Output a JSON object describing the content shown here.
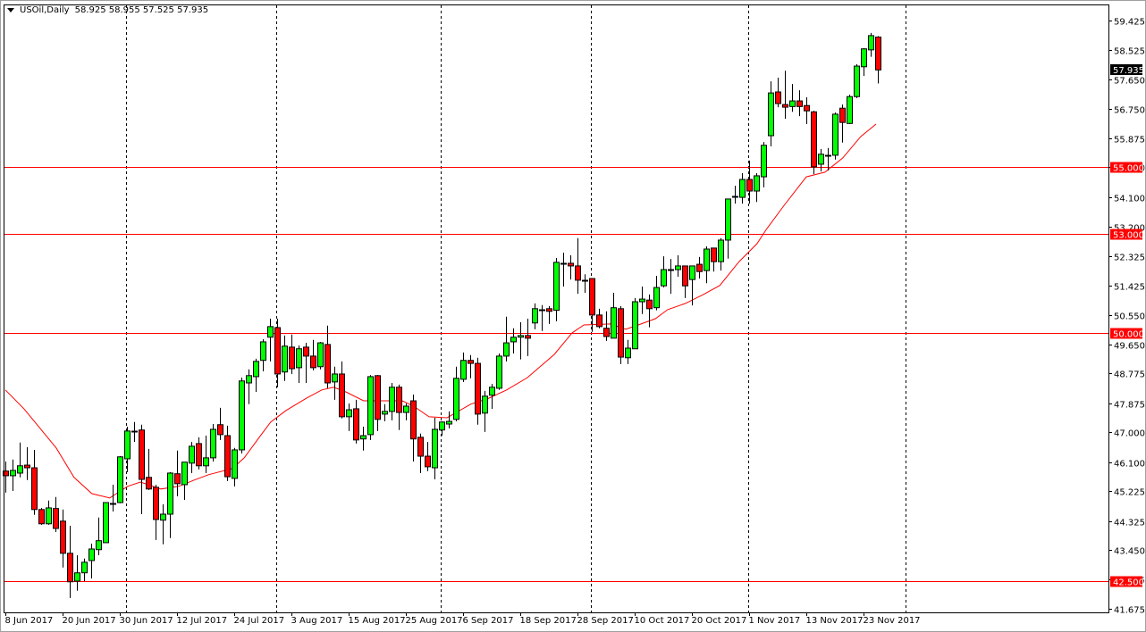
{
  "header": {
    "symbol": "USOil,Daily",
    "ohlc": "58.925 58.955 57.525 57.935"
  },
  "colors": {
    "up": "#00ff00",
    "down": "#ff0000",
    "outline": "#000000",
    "level": "#ff0000",
    "ma": "#ff0000",
    "current_bg": "#000000"
  },
  "chart_data": {
    "type": "candlestick",
    "title": "USOil,Daily",
    "ylim": [
      41.675,
      59.425
    ],
    "y_ticks": [
      "59.425",
      "58.525",
      "57.650",
      "56.750",
      "55.875",
      "55.000",
      "54.100",
      "53.200",
      "52.325",
      "51.425",
      "50.550",
      "49.650",
      "48.775",
      "47.875",
      "47.000",
      "46.100",
      "45.225",
      "44.325",
      "43.450",
      "42.575",
      "41.675"
    ],
    "x_labels": [
      {
        "index": 0,
        "label": "8 Jun 2017"
      },
      {
        "index": 8,
        "label": "20 Jun 2017"
      },
      {
        "index": 16,
        "label": "30 Jun 2017"
      },
      {
        "index": 24,
        "label": "12 Jul 2017"
      },
      {
        "index": 32,
        "label": "24 Jul 2017"
      },
      {
        "index": 40,
        "label": "3 Aug 2017"
      },
      {
        "index": 48,
        "label": "15 Aug 2017"
      },
      {
        "index": 56,
        "label": "25 Aug 2017"
      },
      {
        "index": 64,
        "label": "6 Sep 2017"
      },
      {
        "index": 72,
        "label": "18 Sep 2017"
      },
      {
        "index": 80,
        "label": "28 Sep 2017"
      },
      {
        "index": 88,
        "label": "10 Oct 2017"
      },
      {
        "index": 96,
        "label": "20 Oct 2017"
      },
      {
        "index": 104,
        "label": "1 Nov 2017"
      },
      {
        "index": 112,
        "label": "13 Nov 2017"
      },
      {
        "index": 120,
        "label": "23 Nov 2017"
      }
    ],
    "period_separators": [
      17,
      38,
      61,
      82,
      104,
      126
    ],
    "levels": [
      {
        "price": 55.0,
        "label": "55.000"
      },
      {
        "price": 53.0,
        "label": "53.000"
      },
      {
        "price": 50.0,
        "label": "50.000"
      },
      {
        "price": 42.5,
        "label": "42.500"
      }
    ],
    "current_price": {
      "price": 57.935,
      "label": "57.935"
    },
    "ohlc": [
      [
        45.83,
        46.12,
        45.18,
        45.69
      ],
      [
        45.69,
        46.18,
        45.23,
        45.85
      ],
      [
        45.77,
        46.69,
        45.64,
        45.99
      ],
      [
        46.01,
        46.55,
        45.56,
        45.93
      ],
      [
        45.93,
        46.47,
        44.51,
        44.67
      ],
      [
        44.67,
        44.72,
        44.21,
        44.24
      ],
      [
        44.24,
        44.94,
        44.21,
        44.72
      ],
      [
        44.7,
        45.05,
        43.99,
        44.1
      ],
      [
        44.32,
        44.67,
        42.92,
        43.35
      ],
      [
        43.35,
        44.18,
        42.0,
        42.49
      ],
      [
        42.51,
        43.29,
        42.22,
        42.76
      ],
      [
        42.76,
        43.19,
        42.51,
        43.08
      ],
      [
        43.13,
        43.64,
        42.59,
        43.48
      ],
      [
        43.46,
        44.43,
        43.29,
        43.73
      ],
      [
        43.67,
        44.88,
        43.67,
        44.88
      ],
      [
        44.83,
        45.42,
        44.61,
        44.84
      ],
      [
        44.88,
        46.28,
        44.86,
        46.26
      ],
      [
        46.2,
        47.17,
        45.8,
        47.04
      ],
      [
        47.04,
        47.31,
        46.71,
        47.03
      ],
      [
        47.07,
        47.23,
        44.53,
        45.58
      ],
      [
        45.64,
        46.5,
        45.26,
        45.29
      ],
      [
        45.34,
        45.42,
        43.75,
        44.37
      ],
      [
        44.35,
        44.83,
        43.62,
        44.53
      ],
      [
        44.53,
        45.8,
        43.81,
        45.77
      ],
      [
        45.75,
        46.45,
        45.07,
        45.45
      ],
      [
        45.42,
        46.1,
        44.96,
        46.1
      ],
      [
        46.07,
        46.71,
        45.77,
        46.58
      ],
      [
        46.66,
        46.85,
        45.88,
        45.99
      ],
      [
        45.99,
        46.9,
        45.77,
        46.23
      ],
      [
        46.23,
        47.25,
        46.12,
        47.09
      ],
      [
        47.23,
        47.74,
        46.77,
        46.93
      ],
      [
        46.9,
        47.2,
        45.53,
        45.66
      ],
      [
        45.61,
        46.53,
        45.37,
        46.47
      ],
      [
        46.47,
        48.65,
        46.36,
        48.55
      ],
      [
        48.49,
        48.9,
        47.85,
        48.71
      ],
      [
        48.68,
        49.22,
        48.22,
        49.14
      ],
      [
        49.17,
        49.81,
        48.84,
        49.73
      ],
      [
        49.87,
        50.43,
        49.14,
        50.19
      ],
      [
        50.16,
        50.43,
        48.36,
        48.76
      ],
      [
        48.82,
        49.92,
        48.55,
        49.6
      ],
      [
        49.57,
        49.95,
        48.76,
        48.92
      ],
      [
        48.95,
        49.62,
        48.49,
        49.52
      ],
      [
        49.57,
        49.7,
        48.49,
        49.3
      ],
      [
        49.3,
        49.79,
        48.87,
        48.95
      ],
      [
        48.98,
        49.73,
        48.9,
        49.7
      ],
      [
        49.65,
        50.22,
        48.33,
        48.49
      ],
      [
        48.52,
        48.98,
        47.98,
        48.76
      ],
      [
        48.76,
        49.14,
        47.42,
        47.47
      ],
      [
        47.47,
        47.87,
        47.04,
        47.68
      ],
      [
        47.71,
        47.98,
        46.66,
        46.77
      ],
      [
        46.8,
        47.17,
        46.45,
        46.9
      ],
      [
        46.93,
        48.73,
        46.77,
        48.68
      ],
      [
        48.71,
        48.73,
        47.04,
        47.39
      ],
      [
        47.55,
        47.85,
        47.33,
        47.63
      ],
      [
        47.63,
        48.49,
        47.36,
        48.36
      ],
      [
        48.36,
        48.44,
        47.07,
        47.6
      ],
      [
        47.6,
        47.87,
        47.36,
        47.79
      ],
      [
        47.95,
        48.14,
        46.12,
        46.8
      ],
      [
        46.85,
        46.96,
        45.77,
        46.28
      ],
      [
        46.28,
        46.71,
        45.83,
        45.96
      ],
      [
        45.93,
        47.44,
        45.58,
        47.09
      ],
      [
        47.07,
        47.33,
        46.9,
        47.31
      ],
      [
        47.25,
        47.63,
        47.12,
        47.33
      ],
      [
        47.39,
        48.98,
        47.33,
        48.63
      ],
      [
        48.6,
        49.41,
        48.52,
        49.17
      ],
      [
        49.17,
        49.33,
        48.63,
        49.08
      ],
      [
        49.08,
        49.25,
        47.23,
        47.55
      ],
      [
        47.58,
        48.25,
        47.01,
        48.09
      ],
      [
        48.12,
        48.46,
        47.71,
        48.36
      ],
      [
        48.33,
        49.38,
        48.28,
        49.3
      ],
      [
        49.3,
        50.49,
        49.14,
        49.7
      ],
      [
        49.73,
        50.14,
        49.38,
        49.87
      ],
      [
        49.87,
        50.32,
        49.2,
        49.92
      ],
      [
        49.92,
        50.43,
        49.3,
        49.84
      ],
      [
        50.3,
        50.89,
        50.11,
        50.73
      ],
      [
        50.7,
        50.84,
        50.06,
        50.71
      ],
      [
        50.73,
        50.81,
        50.27,
        50.65
      ],
      [
        50.68,
        52.26,
        50.35,
        52.13
      ],
      [
        52.1,
        52.42,
        51.4,
        52.11
      ],
      [
        52.1,
        52.34,
        51.61,
        52.02
      ],
      [
        52.02,
        52.86,
        51.18,
        51.59
      ],
      [
        51.59,
        51.77,
        51.21,
        51.6
      ],
      [
        51.64,
        51.64,
        50.03,
        50.54
      ],
      [
        50.54,
        50.73,
        50.14,
        50.19
      ],
      [
        50.14,
        50.65,
        49.76,
        49.89
      ],
      [
        49.84,
        51.21,
        49.84,
        50.76
      ],
      [
        50.73,
        50.81,
        49.06,
        49.27
      ],
      [
        49.25,
        49.79,
        49.06,
        49.54
      ],
      [
        49.52,
        51.05,
        49.52,
        50.94
      ],
      [
        50.94,
        51.4,
        50.57,
        51.02
      ],
      [
        50.99,
        51.16,
        50.17,
        50.73
      ],
      [
        50.76,
        51.72,
        50.68,
        51.37
      ],
      [
        51.42,
        52.31,
        51.37,
        51.91
      ],
      [
        51.91,
        52.23,
        51.18,
        51.92
      ],
      [
        51.91,
        52.34,
        51.69,
        52.02
      ],
      [
        52.02,
        52.02,
        51.05,
        51.42
      ],
      [
        51.61,
        52.02,
        50.83,
        52.02
      ],
      [
        52.07,
        52.29,
        51.64,
        51.85
      ],
      [
        51.88,
        52.61,
        51.5,
        52.53
      ],
      [
        52.56,
        52.56,
        51.85,
        52.15
      ],
      [
        52.15,
        52.86,
        51.88,
        52.8
      ],
      [
        52.8,
        54.04,
        52.24,
        54.04
      ],
      [
        54.12,
        54.44,
        53.9,
        54.13
      ],
      [
        54.09,
        54.82,
        53.9,
        54.63
      ],
      [
        54.63,
        55.2,
        53.9,
        54.28
      ],
      [
        54.28,
        54.82,
        53.95,
        54.74
      ],
      [
        54.71,
        55.76,
        54.39,
        55.66
      ],
      [
        55.95,
        57.59,
        55.63,
        57.24
      ],
      [
        57.27,
        57.7,
        56.81,
        56.92
      ],
      [
        56.89,
        57.91,
        56.46,
        56.81
      ],
      [
        56.83,
        57.51,
        56.67,
        57.0
      ],
      [
        57.0,
        57.32,
        56.54,
        56.83
      ],
      [
        56.86,
        57.11,
        56.3,
        56.7
      ],
      [
        56.67,
        56.7,
        54.79,
        55.01
      ],
      [
        55.09,
        55.55,
        54.87,
        55.39
      ],
      [
        55.34,
        55.58,
        54.9,
        55.35
      ],
      [
        55.36,
        56.65,
        55.23,
        56.6
      ],
      [
        56.78,
        56.89,
        55.74,
        56.35
      ],
      [
        56.32,
        57.19,
        56.3,
        57.13
      ],
      [
        57.13,
        58.11,
        57.08,
        58.05
      ],
      [
        58.03,
        58.59,
        57.75,
        58.57
      ],
      [
        58.54,
        59.05,
        58.33,
        58.97
      ],
      [
        58.925,
        58.955,
        57.525,
        57.935
      ]
    ],
    "moving_average": [
      [
        0,
        48.28
      ],
      [
        2.6,
        47.71
      ],
      [
        7.1,
        46.53
      ],
      [
        9.6,
        45.64
      ],
      [
        12.1,
        45.15
      ],
      [
        14.6,
        45.02
      ],
      [
        17.1,
        45.37
      ],
      [
        18.9,
        45.5
      ],
      [
        21.75,
        45.29
      ],
      [
        24.25,
        45.37
      ],
      [
        26.4,
        45.56
      ],
      [
        28.4,
        45.72
      ],
      [
        31.75,
        45.91
      ],
      [
        33.4,
        46.23
      ],
      [
        35.5,
        46.85
      ],
      [
        37.1,
        47.31
      ],
      [
        39.25,
        47.66
      ],
      [
        42.1,
        48.03
      ],
      [
        44.25,
        48.28
      ],
      [
        45.9,
        48.36
      ],
      [
        47.6,
        48.22
      ],
      [
        50.1,
        47.95
      ],
      [
        55.5,
        47.95
      ],
      [
        57.1,
        47.79
      ],
      [
        59.25,
        47.47
      ],
      [
        61.75,
        47.44
      ],
      [
        65.1,
        47.85
      ],
      [
        67.6,
        48.03
      ],
      [
        70.1,
        48.28
      ],
      [
        73,
        48.65
      ],
      [
        76.75,
        49.35
      ],
      [
        79.25,
        50.0
      ],
      [
        80.9,
        50.24
      ],
      [
        84.6,
        50.27
      ],
      [
        86.75,
        50.11
      ],
      [
        88.9,
        50.27
      ],
      [
        90.9,
        50.43
      ],
      [
        92.6,
        50.7
      ],
      [
        95.1,
        50.89
      ],
      [
        97.6,
        51.16
      ],
      [
        99.9,
        51.43
      ],
      [
        102.6,
        52.15
      ],
      [
        105.1,
        52.69
      ],
      [
        106.4,
        53.12
      ],
      [
        108.9,
        53.85
      ],
      [
        112,
        54.71
      ],
      [
        114.6,
        54.85
      ],
      [
        117.1,
        55.28
      ],
      [
        119.6,
        55.92
      ],
      [
        121.75,
        56.3
      ]
    ]
  }
}
